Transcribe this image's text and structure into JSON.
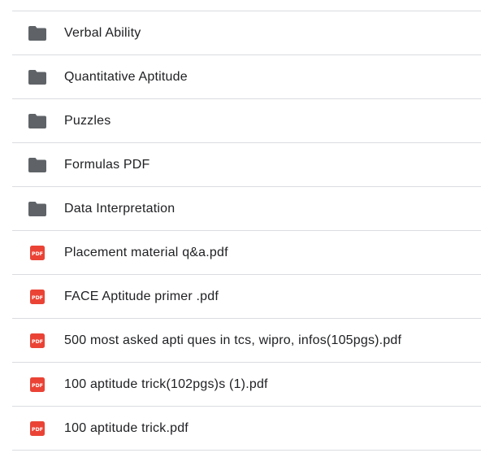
{
  "colors": {
    "folder": "#5f6368",
    "pdf": "#ea4335",
    "divider": "#dadce0",
    "text": "#202124"
  },
  "files": [
    {
      "name": "Verbal Ability",
      "icon": "folder-icon"
    },
    {
      "name": "Quantitative Aptitude",
      "icon": "folder-icon"
    },
    {
      "name": "Puzzles",
      "icon": "folder-icon"
    },
    {
      "name": "Formulas PDF",
      "icon": "folder-icon"
    },
    {
      "name": "Data Interpretation",
      "icon": "folder-icon"
    },
    {
      "name": "Placement material q&a.pdf",
      "icon": "pdf-icon",
      "badge": "PDF"
    },
    {
      "name": "FACE Aptitude primer .pdf",
      "icon": "pdf-icon",
      "badge": "PDF"
    },
    {
      "name": "500 most asked apti ques in tcs, wipro, infos(105pgs).pdf",
      "icon": "pdf-icon",
      "badge": "PDF"
    },
    {
      "name": "100 aptitude trick(102pgs)s (1).pdf",
      "icon": "pdf-icon",
      "badge": "PDF"
    },
    {
      "name": "100 aptitude trick.pdf",
      "icon": "pdf-icon",
      "badge": "PDF"
    }
  ]
}
